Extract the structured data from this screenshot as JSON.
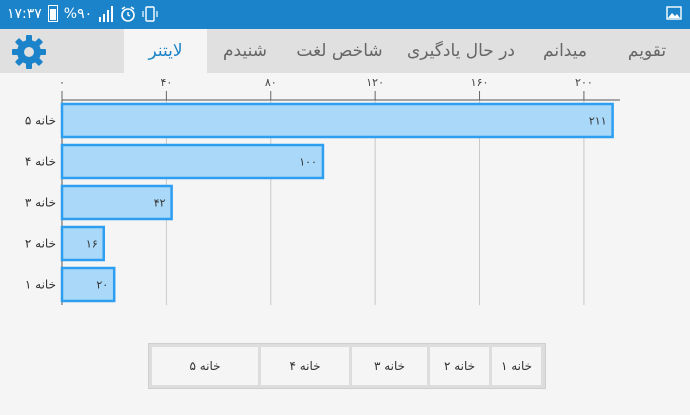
{
  "statusbar": {
    "time": "۱۷:۳۷",
    "battery_text": "%۹۰"
  },
  "tabs": [
    {
      "label": "تقویم"
    },
    {
      "label": "میدانم"
    },
    {
      "label": "در حال یادگیری"
    },
    {
      "label": "شاخص لغت"
    },
    {
      "label": "شنیدم"
    },
    {
      "label": "لایتنر",
      "active": true
    }
  ],
  "colors": {
    "accent": "#1a83c9",
    "bar_fill": "#a9d8f8",
    "bar_stroke": "#2e9ef0"
  },
  "chart_data": {
    "type": "bar",
    "orientation": "horizontal",
    "categories": [
      "خانه ۵",
      "خانه ۴",
      "خانه ۳",
      "خانه ۲",
      "خانه ۱"
    ],
    "values": [
      211,
      100,
      42,
      16,
      20
    ],
    "value_labels": [
      "۲۱۱",
      "۱۰۰",
      "۴۲",
      "۱۶",
      "۲۰"
    ],
    "xlim": [
      0,
      210
    ],
    "xticks": [
      0,
      40,
      80,
      120,
      160,
      200
    ],
    "xtick_labels": [
      "۰",
      "۴۰",
      "۸۰",
      "۱۲۰",
      "۱۶۰",
      "۲۰۰"
    ],
    "xaxis_position": "top",
    "grid": true
  },
  "legend": {
    "items": [
      "خانه ۱",
      "خانه ۲",
      "خانه ۳",
      "خانه ۴",
      "خانه ۵"
    ]
  }
}
